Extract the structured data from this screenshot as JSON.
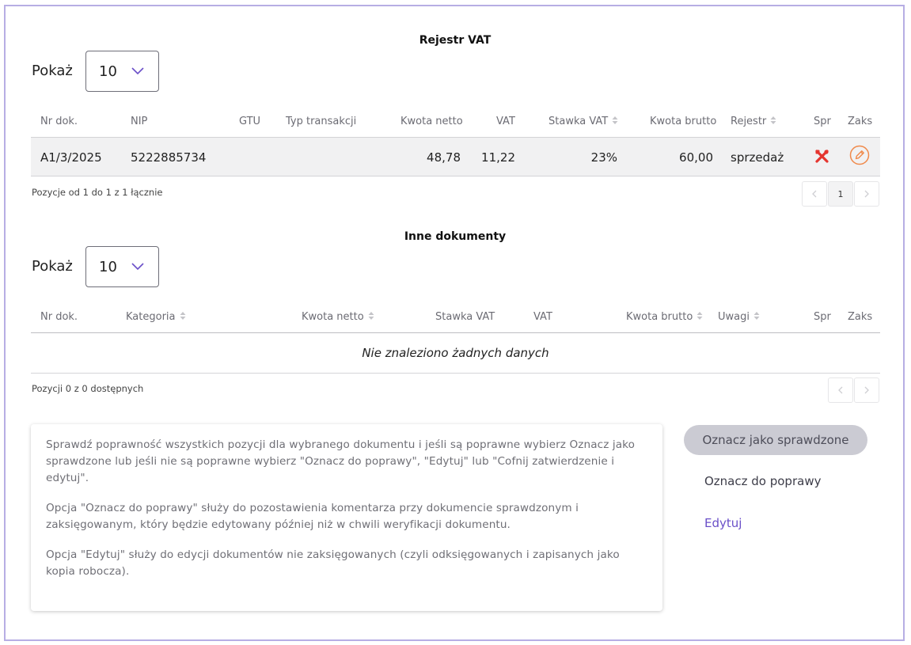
{
  "vat": {
    "title": "Rejestr VAT",
    "show_label": "Pokaż",
    "page_size": "10",
    "headers": {
      "nr": "Nr dok.",
      "nip": "NIP",
      "gtu": "GTU",
      "typ": "Typ transakcji",
      "netto": "Kwota netto",
      "vat": "VAT",
      "stawka": "Stawka VAT",
      "brutto": "Kwota brutto",
      "rejestr": "Rejestr",
      "spr": "Spr",
      "zaks": "Zaks"
    },
    "rows": [
      {
        "nr": "A1/3/2025",
        "nip": "5222885734",
        "gtu": "",
        "typ": "",
        "netto": "48,78",
        "vat": "11,22",
        "stawka": "23%",
        "brutto": "60,00",
        "rejestr": "sprzedaż"
      }
    ],
    "info": "Pozycje od 1 do 1 z 1 łącznie",
    "current_page": "1"
  },
  "other": {
    "title": "Inne dokumenty",
    "show_label": "Pokaż",
    "page_size": "10",
    "headers": {
      "nr": "Nr dok.",
      "kategoria": "Kategoria",
      "netto": "Kwota netto",
      "stawka": "Stawka VAT",
      "vat": "VAT",
      "brutto": "Kwota brutto",
      "uwagi": "Uwagi",
      "spr": "Spr",
      "zaks": "Zaks"
    },
    "empty_text": "Nie znaleziono żadnych danych",
    "info": "Pozycji 0 z 0 dostępnych"
  },
  "help": {
    "p1": "Sprawdź poprawność wszystkich pozycji dla wybranego dokumentu i jeśli są poprawne wybierz Oznacz jako sprawdzone lub jeśli nie są poprawne wybierz \"Oznacz do poprawy\", \"Edytuj\" lub \"Cofnij zatwierdzenie i edytuj\".",
    "p2": "Opcja \"Oznacz do poprawy\" służy do pozostawienia komentarza przy dokumencie sprawdzonym i zaksięgowanym, który będzie edytowany później niż w chwili weryfikacji dokumentu.",
    "p3": "Opcja \"Edytuj\" służy do edycji dokumentów nie zaksięgowanych (czyli odksięgowanych i zapisanych jako kopia robocza)."
  },
  "actions": {
    "mark_checked": "Oznacz jako sprawdzone",
    "mark_fix": "Oznacz do poprawy",
    "edit": "Edytuj"
  },
  "colors": {
    "frame": "#b7aee4",
    "accent": "#6a4fc8",
    "spr_icon": "#e5352f",
    "zaks_icon": "#f0894a"
  },
  "icons": {
    "spr": "tools-cross-icon",
    "zaks": "pencil-circle-icon"
  }
}
